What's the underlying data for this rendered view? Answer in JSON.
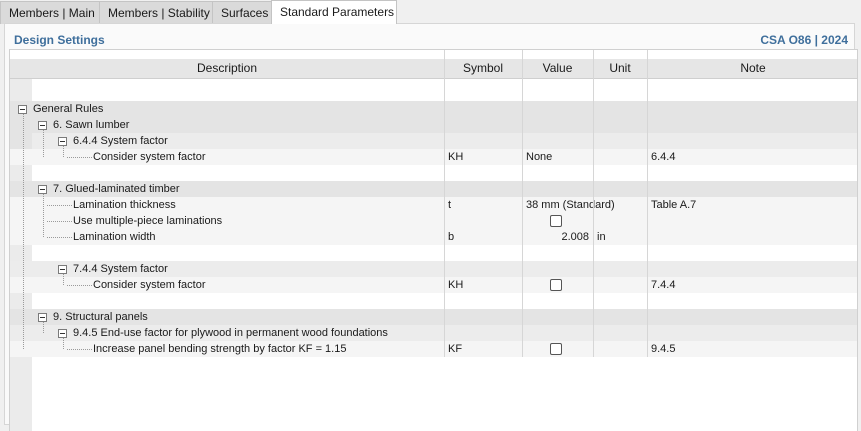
{
  "tabs": [
    {
      "label": "Members | Main"
    },
    {
      "label": "Members | Stability"
    },
    {
      "label": "Surfaces"
    },
    {
      "label": "Standard Parameters"
    }
  ],
  "panel": {
    "title": "Design Settings",
    "standard": "CSA O86 | 2024"
  },
  "columns": {
    "description": "Description",
    "symbol": "Symbol",
    "value": "Value",
    "unit": "Unit",
    "note": "Note"
  },
  "tree": {
    "general": "General Rules",
    "s6": {
      "label": "6. Sawn lumber",
      "sub": "6.4.4 System factor",
      "row": {
        "desc": "Consider system factor",
        "symbol": "KH",
        "value": "None",
        "note": "6.4.4"
      }
    },
    "s7": {
      "label": "7. Glued-laminated timber",
      "lam_thickness": {
        "desc": "Lamination thickness",
        "symbol": "t",
        "value": "38 mm (Standard)",
        "note": "Table A.7"
      },
      "multi_piece": {
        "desc": "Use multiple-piece laminations",
        "checked": false
      },
      "lam_width": {
        "desc": "Lamination width",
        "symbol": "b",
        "value": "2.008",
        "unit": "in"
      },
      "sub": "7.4.4 System factor",
      "row": {
        "desc": "Consider system factor",
        "symbol": "KH",
        "checked": false,
        "note": "7.4.4"
      }
    },
    "s9": {
      "label": "9. Structural panels",
      "sub": "9.4.5 End-use factor for plywood in permanent wood foundations",
      "row": {
        "desc": "Increase panel bending strength by factor KF = 1.15",
        "symbol": "KF",
        "checked": false,
        "note": "9.4.5"
      }
    }
  }
}
